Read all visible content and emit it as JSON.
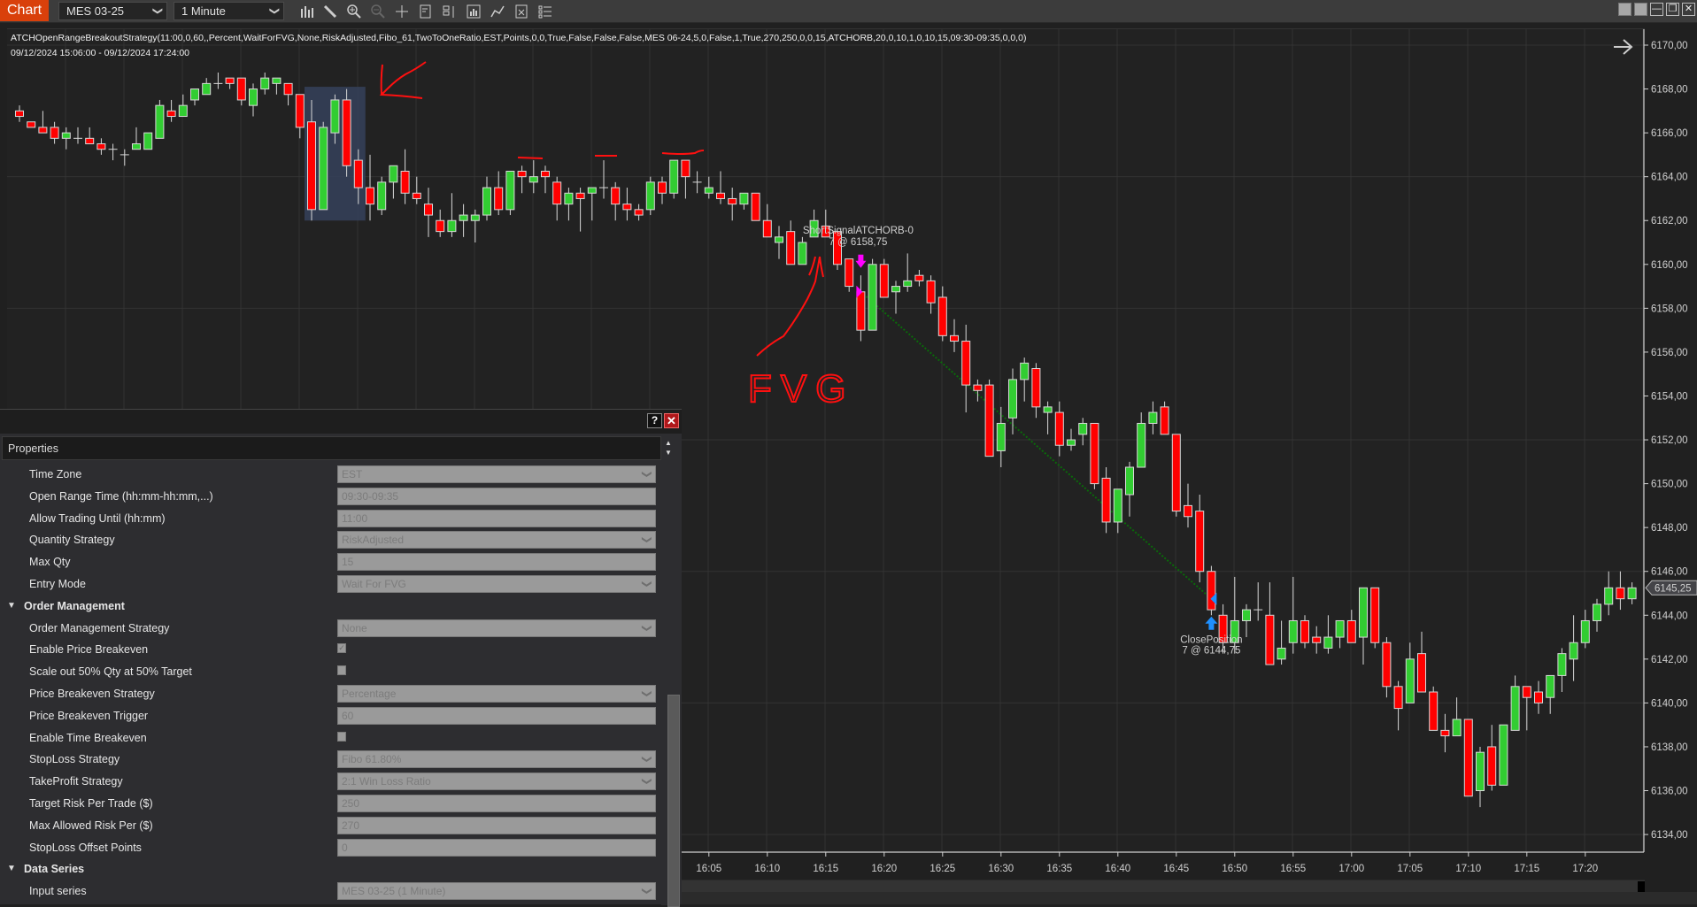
{
  "app": {
    "tab_label": "Chart",
    "instrument": "MES 03-25",
    "interval": "1 Minute",
    "toolbar_icons": [
      "bar-type-icon",
      "drawing-tool-icon",
      "zoom-in-icon",
      "zoom-out-icon",
      "crosshair-icon",
      "data-box-icon",
      "chart-trader-icon",
      "indicators-icon",
      "strategies-icon",
      "templates-icon",
      "properties-icon"
    ],
    "window_buttons": [
      "tile-icon",
      "tile-icon",
      "minimize-icon",
      "restore-icon",
      "close-icon"
    ]
  },
  "chart": {
    "strategy_label": "ATCHOpenRangeBreakoutStrategy(11:00,0,60,,Percent,WaitForFVG,None,RiskAdjusted,Fibo_61,TwoToOneRatio,EST,Points,0,0,True,False,False,False,MES 06-24,5,0,False,1,True,270,250,0,0,15,ATCHORB,20,0,10,1,0,10,15,09:30-09:35,0,0,0)",
    "range_label": "09/12/2024 15:06:00 - 09/12/2024 17:24:00",
    "last_price_label": "6145,25",
    "entry": {
      "name": "ShortSignalATCHORB-0",
      "detail": "7 @ 6158,75",
      "price": 6158.75,
      "bar_index": 72
    },
    "exit": {
      "name": "ClosePosition",
      "detail": "7 @ 6144,75",
      "price": 6144.75,
      "bar_index": 102
    },
    "annotation_text": "FVG",
    "colors": {
      "up": "#32cd32",
      "down": "#ff0000",
      "wick": "#d8d8d8",
      "grid": "#333333",
      "entry_marker": "#ff00ff",
      "exit_marker": "#1e90ff",
      "trade_line": "#0a6a0a",
      "annotation": "#ff1010",
      "highlight": "#35415a"
    }
  },
  "chart_data": {
    "type": "candlestick",
    "title": "MES 03-25 1 Minute",
    "start_time": "15:06",
    "bar_minutes": 1,
    "ylim": [
      6133.5,
      6170.8
    ],
    "yticks": [
      "6170,00",
      "6168,00",
      "6166,00",
      "6164,00",
      "6162,00",
      "6160,00",
      "6158,00",
      "6156,00",
      "6154,00",
      "6152,00",
      "6150,00",
      "6148,00",
      "6146,00",
      "6144,00",
      "6142,00",
      "6140,00",
      "6138,00",
      "6136,00",
      "6134,00"
    ],
    "xticks": [
      "16:05",
      "16:10",
      "16:15",
      "16:20",
      "16:25",
      "16:30",
      "16:35",
      "16:40",
      "16:45",
      "16:50",
      "16:55",
      "17:00",
      "17:05",
      "17:10",
      "17:15",
      "17:20"
    ],
    "grid": true,
    "bars": [
      [
        6167.0,
        6167.25,
        6166.5,
        6166.75
      ],
      [
        6166.5,
        6166.5,
        6166.25,
        6166.25
      ],
      [
        6166.25,
        6167.0,
        6166.0,
        6166.0
      ],
      [
        6166.25,
        6166.5,
        6165.5,
        6165.75
      ],
      [
        6165.75,
        6166.25,
        6165.25,
        6166.0
      ],
      [
        6165.75,
        6166.25,
        6165.5,
        6165.75
      ],
      [
        6165.75,
        6166.25,
        6165.5,
        6165.5
      ],
      [
        6165.5,
        6165.75,
        6165.0,
        6165.25
      ],
      [
        6165.25,
        6165.5,
        6164.75,
        6165.25
      ],
      [
        6165.0,
        6165.25,
        6164.5,
        6165.0
      ],
      [
        6165.25,
        6166.25,
        6165.25,
        6165.5
      ],
      [
        6165.25,
        6166.0,
        6165.25,
        6166.0
      ],
      [
        6165.75,
        6167.5,
        6165.75,
        6167.25
      ],
      [
        6167.0,
        6167.5,
        6166.5,
        6166.75
      ],
      [
        6166.75,
        6167.75,
        6166.75,
        6167.25
      ],
      [
        6167.5,
        6168.0,
        6167.25,
        6168.0
      ],
      [
        6167.75,
        6168.5,
        6167.75,
        6168.25
      ],
      [
        6168.25,
        6168.75,
        6168.0,
        6168.25
      ],
      [
        6168.5,
        6168.5,
        6168.0,
        6168.25
      ],
      [
        6168.5,
        6168.5,
        6167.25,
        6167.5
      ],
      [
        6167.25,
        6168.25,
        6166.75,
        6168.0
      ],
      [
        6168.0,
        6168.75,
        6167.75,
        6168.5
      ],
      [
        6168.25,
        6168.5,
        6167.75,
        6168.5
      ],
      [
        6168.25,
        6168.25,
        6167.25,
        6167.75
      ],
      [
        6167.75,
        6167.75,
        6165.75,
        6166.25
      ],
      [
        6166.5,
        6167.5,
        6162.0,
        6162.5
      ],
      [
        6162.5,
        6166.5,
        6162.5,
        6166.25
      ],
      [
        6166.0,
        6167.75,
        6165.5,
        6167.5
      ],
      [
        6167.5,
        6168.0,
        6164.0,
        6164.5
      ],
      [
        6164.75,
        6165.25,
        6162.75,
        6163.5
      ],
      [
        6163.5,
        6165.0,
        6162.0,
        6162.75
      ],
      [
        6162.5,
        6164.0,
        6162.25,
        6163.75
      ],
      [
        6163.75,
        6164.5,
        6163.0,
        6164.5
      ],
      [
        6164.25,
        6165.25,
        6162.75,
        6163.25
      ],
      [
        6163.25,
        6164.0,
        6162.75,
        6163.0
      ],
      [
        6162.75,
        6163.5,
        6161.25,
        6162.25
      ],
      [
        6162.0,
        6162.5,
        6161.25,
        6161.5
      ],
      [
        6161.5,
        6163.25,
        6161.25,
        6162.0
      ],
      [
        6162.0,
        6162.75,
        6161.25,
        6162.25
      ],
      [
        6162.0,
        6162.5,
        6161.0,
        6162.25
      ],
      [
        6162.25,
        6164.0,
        6162.0,
        6163.5
      ],
      [
        6163.5,
        6164.25,
        6162.25,
        6162.5
      ],
      [
        6162.5,
        6164.25,
        6162.25,
        6164.25
      ],
      [
        6164.25,
        6164.5,
        6163.25,
        6164.0
      ],
      [
        6163.75,
        6164.75,
        6163.25,
        6164.0
      ],
      [
        6164.25,
        6164.5,
        6163.25,
        6164.0
      ],
      [
        6163.75,
        6164.0,
        6162.0,
        6162.75
      ],
      [
        6162.75,
        6163.5,
        6162.0,
        6163.25
      ],
      [
        6163.25,
        6163.5,
        6161.5,
        6163.0
      ],
      [
        6163.25,
        6163.5,
        6162.0,
        6163.5
      ],
      [
        6163.5,
        6164.75,
        6163.0,
        6163.5
      ],
      [
        6163.5,
        6163.75,
        6162.0,
        6162.75
      ],
      [
        6162.75,
        6163.5,
        6162.0,
        6162.5
      ],
      [
        6162.5,
        6162.75,
        6162.0,
        6162.25
      ],
      [
        6162.5,
        6164.0,
        6162.25,
        6163.75
      ],
      [
        6163.75,
        6164.0,
        6162.75,
        6163.25
      ],
      [
        6163.25,
        6164.75,
        6163.0,
        6164.75
      ],
      [
        6164.75,
        6164.75,
        6163.0,
        6164.0
      ],
      [
        6163.75,
        6164.25,
        6163.25,
        6163.75
      ],
      [
        6163.25,
        6164.0,
        6163.0,
        6163.5
      ],
      [
        6163.25,
        6164.25,
        6162.75,
        6163.0
      ],
      [
        6163.0,
        6163.5,
        6162.0,
        6162.75
      ],
      [
        6162.75,
        6163.25,
        6162.5,
        6163.25
      ],
      [
        6163.25,
        6163.25,
        6162.0,
        6162.0
      ],
      [
        6162.0,
        6162.75,
        6161.25,
        6161.25
      ],
      [
        6161.0,
        6161.75,
        6160.25,
        6161.25
      ],
      [
        6161.5,
        6162.0,
        6160.0,
        6160.0
      ],
      [
        6160.0,
        6161.25,
        6160.0,
        6161.0
      ],
      [
        6161.25,
        6162.5,
        6161.25,
        6162.0
      ],
      [
        6161.75,
        6162.5,
        6161.25,
        6161.25
      ],
      [
        6161.5,
        6161.5,
        6159.75,
        6160.0
      ],
      [
        6160.25,
        6160.25,
        6158.75,
        6159.0
      ],
      [
        6158.75,
        6159.5,
        6156.5,
        6157.0
      ],
      [
        6157.0,
        6160.25,
        6157.0,
        6160.0
      ],
      [
        6160.0,
        6160.25,
        6158.5,
        6158.5
      ],
      [
        6158.75,
        6159.25,
        6157.75,
        6159.0
      ],
      [
        6159.0,
        6160.5,
        6158.75,
        6159.25
      ],
      [
        6159.5,
        6159.75,
        6159.0,
        6159.25
      ],
      [
        6159.25,
        6159.5,
        6157.75,
        6158.25
      ],
      [
        6158.5,
        6159.0,
        6156.5,
        6156.75
      ],
      [
        6156.75,
        6157.5,
        6156.0,
        6156.5
      ],
      [
        6156.5,
        6157.25,
        6153.25,
        6154.5
      ],
      [
        6154.5,
        6154.75,
        6153.75,
        6154.25
      ],
      [
        6154.5,
        6154.75,
        6151.25,
        6151.25
      ],
      [
        6151.5,
        6153.5,
        6150.75,
        6152.75
      ],
      [
        6153.0,
        6155.25,
        6152.25,
        6154.75
      ],
      [
        6154.75,
        6155.75,
        6153.75,
        6155.5
      ],
      [
        6155.25,
        6155.5,
        6153.0,
        6153.5
      ],
      [
        6153.25,
        6153.75,
        6152.25,
        6153.5
      ],
      [
        6153.25,
        6153.75,
        6151.25,
        6151.75
      ],
      [
        6151.75,
        6152.5,
        6151.5,
        6152.0
      ],
      [
        6152.25,
        6153.0,
        6151.75,
        6152.75
      ],
      [
        6152.75,
        6152.75,
        6149.75,
        6150.0
      ],
      [
        6150.25,
        6150.75,
        6147.75,
        6148.25
      ],
      [
        6148.25,
        6149.75,
        6147.75,
        6149.75
      ],
      [
        6149.5,
        6151.0,
        6148.5,
        6150.75
      ],
      [
        6150.75,
        6153.25,
        6150.75,
        6152.75
      ],
      [
        6152.75,
        6153.75,
        6152.25,
        6153.25
      ],
      [
        6153.5,
        6153.75,
        6152.25,
        6152.25
      ],
      [
        6152.25,
        6152.25,
        6148.5,
        6148.75
      ],
      [
        6149.0,
        6150.0,
        6148.0,
        6148.5
      ],
      [
        6148.75,
        6149.5,
        6145.5,
        6146.0
      ],
      [
        6146.0,
        6146.25,
        6144.0,
        6144.25
      ],
      [
        6144.0,
        6144.5,
        6142.25,
        6142.75
      ],
      [
        6142.75,
        6145.75,
        6142.25,
        6143.75
      ],
      [
        6143.75,
        6144.5,
        6143.0,
        6144.25
      ],
      [
        6144.25,
        6145.5,
        6143.75,
        6144.25
      ],
      [
        6144.0,
        6145.5,
        6141.75,
        6141.75
      ],
      [
        6142.0,
        6143.75,
        6141.75,
        6142.5
      ],
      [
        6142.75,
        6145.75,
        6142.25,
        6143.75
      ],
      [
        6143.75,
        6144.0,
        6142.5,
        6142.75
      ],
      [
        6143.0,
        6143.5,
        6142.25,
        6142.75
      ],
      [
        6142.5,
        6144.0,
        6142.25,
        6143.0
      ],
      [
        6143.0,
        6143.75,
        6142.5,
        6143.75
      ],
      [
        6143.75,
        6144.25,
        6142.75,
        6142.75
      ],
      [
        6143.0,
        6145.25,
        6141.75,
        6145.25
      ],
      [
        6145.25,
        6145.25,
        6142.5,
        6142.75
      ],
      [
        6142.75,
        6143.0,
        6140.25,
        6140.75
      ],
      [
        6140.75,
        6141.0,
        6138.75,
        6139.75
      ],
      [
        6140.0,
        6142.75,
        6140.0,
        6142.0
      ],
      [
        6142.25,
        6143.25,
        6140.5,
        6140.5
      ],
      [
        6140.5,
        6140.75,
        6138.75,
        6138.75
      ],
      [
        6138.75,
        6139.5,
        6137.75,
        6138.5
      ],
      [
        6138.5,
        6140.25,
        6138.5,
        6139.25
      ],
      [
        6139.25,
        6139.25,
        6135.75,
        6135.75
      ],
      [
        6136.0,
        6138.0,
        6135.25,
        6137.75
      ],
      [
        6138.0,
        6139.0,
        6136.0,
        6136.25
      ],
      [
        6136.25,
        6139.0,
        6136.25,
        6139.0
      ],
      [
        6138.75,
        6141.25,
        6138.75,
        6140.75
      ],
      [
        6140.75,
        6140.75,
        6138.75,
        6140.25
      ],
      [
        6140.5,
        6141.0,
        6139.5,
        6140.0
      ],
      [
        6140.25,
        6141.25,
        6139.5,
        6141.25
      ],
      [
        6141.25,
        6142.5,
        6140.5,
        6142.25
      ],
      [
        6142.0,
        6144.0,
        6141.0,
        6142.75
      ],
      [
        6142.75,
        6144.25,
        6142.5,
        6143.75
      ],
      [
        6143.75,
        6144.75,
        6143.25,
        6144.5
      ],
      [
        6144.5,
        6146.0,
        6144.0,
        6145.25
      ],
      [
        6145.25,
        6146.0,
        6144.25,
        6144.75
      ],
      [
        6144.75,
        6145.5,
        6144.5,
        6145.25
      ]
    ]
  },
  "properties": {
    "title": "Properties",
    "help_label": "?",
    "close_label": "✕",
    "rows": [
      {
        "type": "dropdown",
        "label": "Time Zone",
        "value": "EST"
      },
      {
        "type": "text",
        "label": "Open Range Time (hh:mm-hh:mm,...)",
        "value": "09:30-09:35"
      },
      {
        "type": "text",
        "label": "Allow Trading Until (hh:mm)",
        "value": "11:00"
      },
      {
        "type": "dropdown",
        "label": "Quantity Strategy",
        "value": "RiskAdjusted"
      },
      {
        "type": "text",
        "label": "Max Qty",
        "value": "15"
      },
      {
        "type": "dropdown",
        "label": "Entry Mode",
        "value": "Wait For FVG"
      },
      {
        "type": "category",
        "label": "Order Management"
      },
      {
        "type": "dropdown",
        "label": "Order Management Strategy",
        "value": "None"
      },
      {
        "type": "checkbox",
        "label": "Enable Price Breakeven",
        "checked": true
      },
      {
        "type": "checkbox",
        "label": "Scale out 50% Qty at 50% Target",
        "checked": false
      },
      {
        "type": "dropdown",
        "label": "Price Breakeven Strategy",
        "value": "Percentage"
      },
      {
        "type": "text",
        "label": "Price Breakeven Trigger",
        "value": "60"
      },
      {
        "type": "checkbox",
        "label": "Enable Time Breakeven",
        "checked": false
      },
      {
        "type": "dropdown",
        "label": "StopLoss Strategy",
        "value": "Fibo 61.80%"
      },
      {
        "type": "dropdown",
        "label": "TakeProfit Strategy",
        "value": "2:1 Win Loss Ratio"
      },
      {
        "type": "text",
        "label": "Target Risk Per Trade ($)",
        "value": "250"
      },
      {
        "type": "text",
        "label": "Max Allowed Risk Per ($)",
        "value": "270"
      },
      {
        "type": "text",
        "label": "StopLoss Offset Points",
        "value": "0"
      },
      {
        "type": "category",
        "label": "Data Series"
      },
      {
        "type": "dropdown",
        "label": "Input series",
        "value": "MES 03-25 (1 Minute)"
      }
    ]
  }
}
